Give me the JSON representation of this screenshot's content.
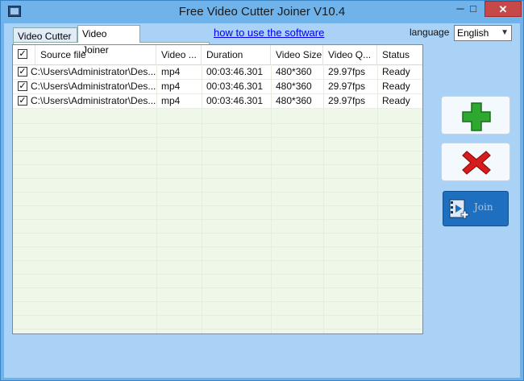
{
  "window": {
    "title": "Free Video Cutter Joiner V10.4"
  },
  "title_controls": {
    "minimize": "─",
    "maximize": "□",
    "close": "✕"
  },
  "tabs": [
    {
      "label": "Video Cutter",
      "active": false
    },
    {
      "label": "Video Joiner",
      "active": true
    }
  ],
  "howto_link": "how to use the software",
  "language": {
    "label": "language",
    "selected": "English"
  },
  "table": {
    "columns": [
      "Source file",
      "Video ...",
      "Duration",
      "Video Size",
      "Video Q...",
      "Status"
    ],
    "rows": [
      {
        "checked": true,
        "source": "C:\\Users\\Administrator\\Des...",
        "format": "mp4",
        "duration": "00:03:46.301",
        "size": "480*360",
        "quality": "29.97fps",
        "status": "Ready"
      },
      {
        "checked": true,
        "source": "C:\\Users\\Administrator\\Des...",
        "format": "mp4",
        "duration": "00:03:46.301",
        "size": "480*360",
        "quality": "29.97fps",
        "status": "Ready"
      },
      {
        "checked": true,
        "source": "C:\\Users\\Administrator\\Des...",
        "format": "mp4",
        "duration": "00:03:46.301",
        "size": "480*360",
        "quality": "29.97fps",
        "status": "Ready"
      }
    ]
  },
  "buttons": {
    "join_label": "Join"
  },
  "colors": {
    "add": "#2fa82f",
    "remove": "#d81c1c",
    "join": "#1f6fc0"
  }
}
